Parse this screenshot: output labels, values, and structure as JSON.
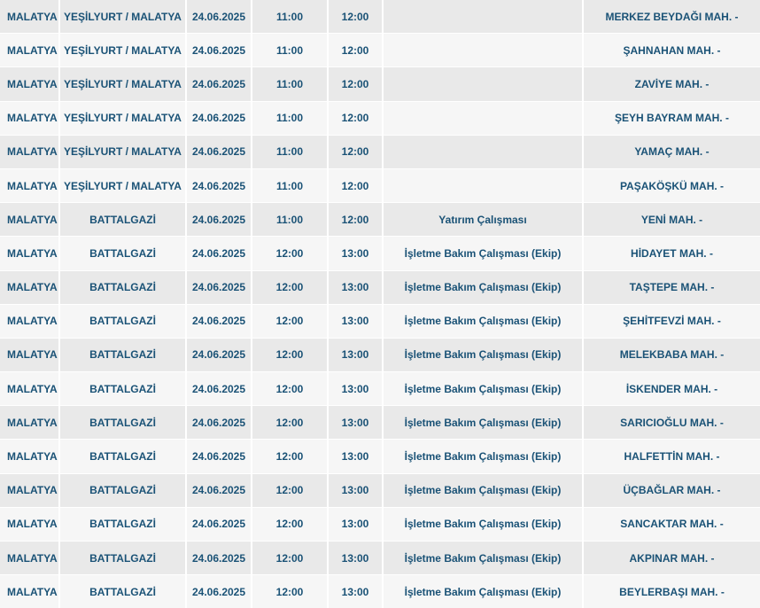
{
  "outage_table": {
    "rows": [
      {
        "il": "MALATYA",
        "ilce": "YEŞİLYURT / MALATYA",
        "tarih": "24.06.2025",
        "baslangic": "11:00",
        "bitis": "12:00",
        "neden": "",
        "mahalle": "MERKEZ BEYDAĞI MAH. -"
      },
      {
        "il": "MALATYA",
        "ilce": "YEŞİLYURT / MALATYA",
        "tarih": "24.06.2025",
        "baslangic": "11:00",
        "bitis": "12:00",
        "neden": "",
        "mahalle": "ŞAHNAHAN MAH. -"
      },
      {
        "il": "MALATYA",
        "ilce": "YEŞİLYURT / MALATYA",
        "tarih": "24.06.2025",
        "baslangic": "11:00",
        "bitis": "12:00",
        "neden": "",
        "mahalle": "ZAVİYE MAH. -"
      },
      {
        "il": "MALATYA",
        "ilce": "YEŞİLYURT / MALATYA",
        "tarih": "24.06.2025",
        "baslangic": "11:00",
        "bitis": "12:00",
        "neden": "",
        "mahalle": "ŞEYH BAYRAM MAH. -"
      },
      {
        "il": "MALATYA",
        "ilce": "YEŞİLYURT / MALATYA",
        "tarih": "24.06.2025",
        "baslangic": "11:00",
        "bitis": "12:00",
        "neden": "",
        "mahalle": "YAMAÇ MAH. -"
      },
      {
        "il": "MALATYA",
        "ilce": "YEŞİLYURT / MALATYA",
        "tarih": "24.06.2025",
        "baslangic": "11:00",
        "bitis": "12:00",
        "neden": "",
        "mahalle": "PAŞAKÖŞKÜ MAH. -"
      },
      {
        "il": "MALATYA",
        "ilce": "BATTALGAZİ",
        "tarih": "24.06.2025",
        "baslangic": "11:00",
        "bitis": "12:00",
        "neden": "Yatırım Çalışması",
        "mahalle": "YENİ MAH. -"
      },
      {
        "il": "MALATYA",
        "ilce": "BATTALGAZİ",
        "tarih": "24.06.2025",
        "baslangic": "12:00",
        "bitis": "13:00",
        "neden": "İşletme Bakım Çalışması (Ekip)",
        "mahalle": "HİDAYET MAH. -"
      },
      {
        "il": "MALATYA",
        "ilce": "BATTALGAZİ",
        "tarih": "24.06.2025",
        "baslangic": "12:00",
        "bitis": "13:00",
        "neden": "İşletme Bakım Çalışması (Ekip)",
        "mahalle": "TAŞTEPE MAH. -"
      },
      {
        "il": "MALATYA",
        "ilce": "BATTALGAZİ",
        "tarih": "24.06.2025",
        "baslangic": "12:00",
        "bitis": "13:00",
        "neden": "İşletme Bakım Çalışması (Ekip)",
        "mahalle": "ŞEHİTFEVZİ MAH. -"
      },
      {
        "il": "MALATYA",
        "ilce": "BATTALGAZİ",
        "tarih": "24.06.2025",
        "baslangic": "12:00",
        "bitis": "13:00",
        "neden": "İşletme Bakım Çalışması (Ekip)",
        "mahalle": "MELEKBABA MAH. -"
      },
      {
        "il": "MALATYA",
        "ilce": "BATTALGAZİ",
        "tarih": "24.06.2025",
        "baslangic": "12:00",
        "bitis": "13:00",
        "neden": "İşletme Bakım Çalışması (Ekip)",
        "mahalle": "İSKENDER MAH. -"
      },
      {
        "il": "MALATYA",
        "ilce": "BATTALGAZİ",
        "tarih": "24.06.2025",
        "baslangic": "12:00",
        "bitis": "13:00",
        "neden": "İşletme Bakım Çalışması (Ekip)",
        "mahalle": "SARICIOĞLU MAH. -"
      },
      {
        "il": "MALATYA",
        "ilce": "BATTALGAZİ",
        "tarih": "24.06.2025",
        "baslangic": "12:00",
        "bitis": "13:00",
        "neden": "İşletme Bakım Çalışması (Ekip)",
        "mahalle": "HALFETTİN MAH. -"
      },
      {
        "il": "MALATYA",
        "ilce": "BATTALGAZİ",
        "tarih": "24.06.2025",
        "baslangic": "12:00",
        "bitis": "13:00",
        "neden": "İşletme Bakım Çalışması (Ekip)",
        "mahalle": "ÜÇBAĞLAR MAH. -"
      },
      {
        "il": "MALATYA",
        "ilce": "BATTALGAZİ",
        "tarih": "24.06.2025",
        "baslangic": "12:00",
        "bitis": "13:00",
        "neden": "İşletme Bakım Çalışması (Ekip)",
        "mahalle": "SANCAKTAR MAH. -"
      },
      {
        "il": "MALATYA",
        "ilce": "BATTALGAZİ",
        "tarih": "24.06.2025",
        "baslangic": "12:00",
        "bitis": "13:00",
        "neden": "İşletme Bakım Çalışması (Ekip)",
        "mahalle": "AKPINAR MAH. -"
      },
      {
        "il": "MALATYA",
        "ilce": "BATTALGAZİ",
        "tarih": "24.06.2025",
        "baslangic": "12:00",
        "bitis": "13:00",
        "neden": "İşletme Bakım Çalışması (Ekip)",
        "mahalle": "BEYLERBAŞI MAH. -"
      }
    ]
  },
  "colors": {
    "text": "#1a5276",
    "row_odd": "#e9e9e9",
    "row_even": "#f6f6f6"
  }
}
